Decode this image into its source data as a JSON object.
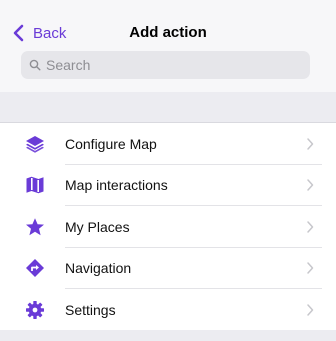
{
  "header": {
    "back_label": "Back",
    "title": "Add action",
    "search_placeholder": "Search"
  },
  "colors": {
    "accent": "#6a3bd7",
    "background": "#f7f7f9",
    "search_bg": "#e6e6ea"
  },
  "items": [
    {
      "label": "Configure Map",
      "icon": "layers-icon"
    },
    {
      "label": "Map interactions",
      "icon": "map-icon"
    },
    {
      "label": "My Places",
      "icon": "star-icon"
    },
    {
      "label": "Navigation",
      "icon": "navigation-diamond-icon"
    },
    {
      "label": "Settings",
      "icon": "gear-icon"
    }
  ]
}
